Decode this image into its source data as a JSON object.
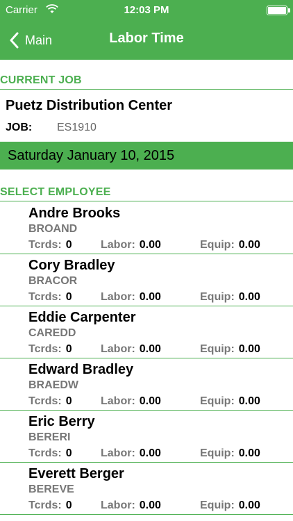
{
  "status_bar": {
    "carrier": "Carrier",
    "time": "12:03 PM"
  },
  "nav": {
    "back_label": "Main",
    "title": "Labor Time"
  },
  "current_job": {
    "header": "CURRENT JOB",
    "name": "Puetz Distribution Center",
    "job_label": "JOB:",
    "job_code": "ES1910"
  },
  "date": "Saturday January 10, 2015",
  "select_employee_header": "SELECT EMPLOYEE",
  "stat_labels": {
    "tcrds": "Tcrds:",
    "labor": "Labor:",
    "equip": "Equip:"
  },
  "employees": [
    {
      "name": "Andre Brooks",
      "code": "BROAND",
      "tcrds": "0",
      "labor": "0.00",
      "equip": "0.00"
    },
    {
      "name": "Cory Bradley",
      "code": "BRACOR",
      "tcrds": "0",
      "labor": "0.00",
      "equip": "0.00"
    },
    {
      "name": "Eddie Carpenter",
      "code": "CAREDD",
      "tcrds": "0",
      "labor": "0.00",
      "equip": "0.00"
    },
    {
      "name": "Edward Bradley",
      "code": "BRAEDW",
      "tcrds": "0",
      "labor": "0.00",
      "equip": "0.00"
    },
    {
      "name": "Eric Berry",
      "code": "BERERI",
      "tcrds": "0",
      "labor": "0.00",
      "equip": "0.00"
    },
    {
      "name": "Everett Berger",
      "code": "BEREVE",
      "tcrds": "0",
      "labor": "0.00",
      "equip": "0.00"
    }
  ],
  "colors": {
    "accent": "#4caf50",
    "muted": "#777777"
  },
  "icons": {
    "back": "chevron-left-icon",
    "wifi": "wifi-icon",
    "battery": "battery-icon"
  }
}
